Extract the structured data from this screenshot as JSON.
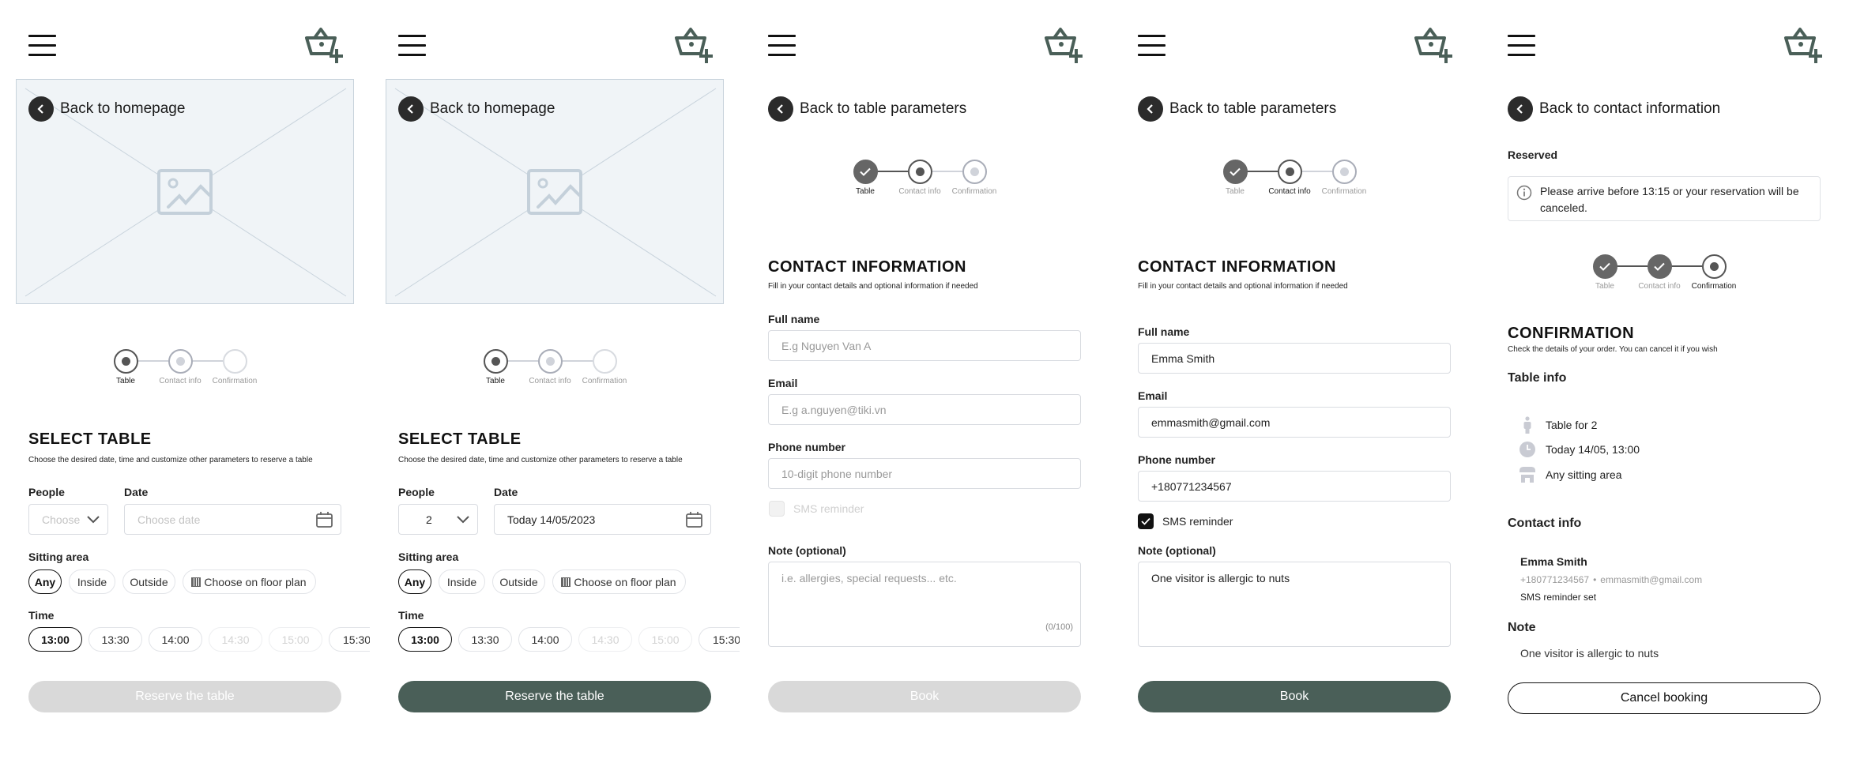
{
  "colors": {
    "accent": "#4a5f58",
    "disabled": "#d9d9d9",
    "back_circle": "#2b2b2b",
    "placeholder_bg": "#f0f4f7"
  },
  "icons": {
    "menu": "hamburger-icon",
    "cart": "basket-plus-icon",
    "back": "chevron-left-icon",
    "calendar": "calendar-icon",
    "dropdown": "chevron-down-icon",
    "floor_plan": "grid-icon",
    "info": "info-circle-icon",
    "person": "person-icon",
    "clock": "clock-icon",
    "store": "storefront-icon",
    "check": "check-icon"
  },
  "stepper_labels": [
    "Table",
    "Contact info",
    "Confirmation"
  ],
  "screens": [
    {
      "back_label": "Back to homepage",
      "stepper": {
        "states": [
          "current",
          "next",
          "future"
        ],
        "active": 0
      },
      "title": "SELECT TABLE",
      "subtitle": "Choose the desired date, time and customize other parameters to reserve a table",
      "people_label": "People",
      "people_placeholder": "Choose",
      "date_label": "Date",
      "date_placeholder": "Choose date",
      "sitting_label": "Sitting area",
      "sitting_options": [
        "Any",
        "Inside",
        "Outside",
        "Choose on floor plan"
      ],
      "sitting_selected": "Any",
      "time_label": "Time",
      "times": [
        "13:00",
        "13:30",
        "14:00",
        "14:30",
        "15:00",
        "15:30"
      ],
      "time_selected": "13:00",
      "times_disabled": [
        "14:30",
        "15:00"
      ],
      "button": "Reserve the table",
      "button_enabled": false
    },
    {
      "back_label": "Back to homepage",
      "stepper": {
        "states": [
          "current",
          "next",
          "future"
        ],
        "active": 0
      },
      "title": "SELECT TABLE",
      "subtitle": "Choose the desired date, time and customize other parameters to reserve a table",
      "people_label": "People",
      "people_value": "2",
      "date_label": "Date",
      "date_value": "Today 14/05/2023",
      "sitting_label": "Sitting area",
      "sitting_options": [
        "Any",
        "Inside",
        "Outside",
        "Choose on floor plan"
      ],
      "sitting_selected": "Any",
      "time_label": "Time",
      "times": [
        "13:00",
        "13:30",
        "14:00",
        "14:30",
        "15:00",
        "15:30"
      ],
      "time_selected": "13:00",
      "times_disabled": [
        "14:30",
        "15:00"
      ],
      "button": "Reserve the table",
      "button_enabled": true
    },
    {
      "back_label": "Back to table parameters",
      "stepper": {
        "states": [
          "done",
          "current",
          "next"
        ],
        "active": 0
      },
      "title": "CONTACT INFORMATION",
      "subtitle": "Fill in your contact details and optional information if needed",
      "name_label": "Full name",
      "name_placeholder": "E.g Nguyen Van A",
      "email_label": "Email",
      "email_placeholder": "E.g a.nguyen@tiki.vn",
      "phone_label": "Phone number",
      "phone_placeholder": "10-digit phone number",
      "sms_label": "SMS reminder",
      "sms_checked": false,
      "note_label": "Note (optional)",
      "note_placeholder": "i.e. allergies, special requests... etc.",
      "note_counter": "(0/100)",
      "button": "Book",
      "button_enabled": false
    },
    {
      "back_label": "Back to table parameters",
      "stepper": {
        "states": [
          "done",
          "current",
          "next"
        ],
        "active": 1
      },
      "title": "CONTACT INFORMATION",
      "subtitle": "Fill in your contact details and optional information if needed",
      "name_label": "Full name",
      "name_value": "Emma Smith",
      "email_label": "Email",
      "email_value": "emmasmith@gmail.com",
      "phone_label": "Phone number",
      "phone_value": "+180771234567",
      "sms_label": "SMS reminder",
      "sms_checked": true,
      "note_label": "Note (optional)",
      "note_value": "One visitor is allergic to nuts",
      "button": "Book",
      "button_enabled": true
    },
    {
      "back_label": "Back to contact information",
      "reserved_label": "Reserved",
      "notice": "Please arrive before 13:15 or your reservation will be canceled.",
      "stepper": {
        "states": [
          "done",
          "done",
          "current"
        ],
        "active": 2
      },
      "title": "CONFIRMATION",
      "subtitle": "Check the details of your order. You can cancel it if you wish",
      "table_info_heading": "Table info",
      "table_info": [
        "Table for 2",
        "Today 14/05, 13:00",
        "Any sitting area"
      ],
      "contact_heading": "Contact info",
      "contact_name": "Emma Smith",
      "contact_phone": "+180771234567",
      "contact_separator": "•",
      "contact_email": "emmasmith@gmail.com",
      "contact_sms": "SMS reminder set",
      "note_heading": "Note",
      "note_text": "One visitor is allergic to nuts",
      "button": "Cancel booking"
    }
  ]
}
